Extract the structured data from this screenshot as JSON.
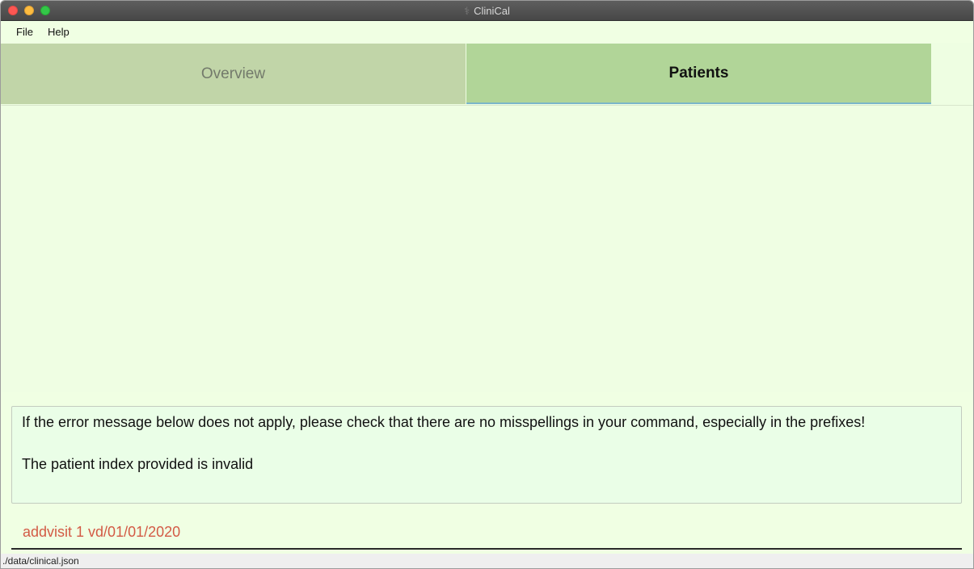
{
  "window": {
    "title": "CliniCal",
    "app_icon": "caduceus-icon"
  },
  "menu": {
    "items": [
      "File",
      "Help"
    ]
  },
  "tabs": [
    {
      "label": "Overview",
      "selected": false
    },
    {
      "label": "Patients",
      "selected": true
    }
  ],
  "result": {
    "lines": [
      "If the error message below does not apply, please check that there are no misspellings in your command, especially in the prefixes!",
      "The patient index provided is invalid"
    ]
  },
  "command": {
    "value": "addvisit 1 vd/01/01/2020",
    "text_color": "#d35a45"
  },
  "status": {
    "path": "./data/clinical.json"
  },
  "colors": {
    "background": "#f0ffe3",
    "tab_selected": "#b1d598",
    "tab_unselected": "#c1d5a8"
  }
}
